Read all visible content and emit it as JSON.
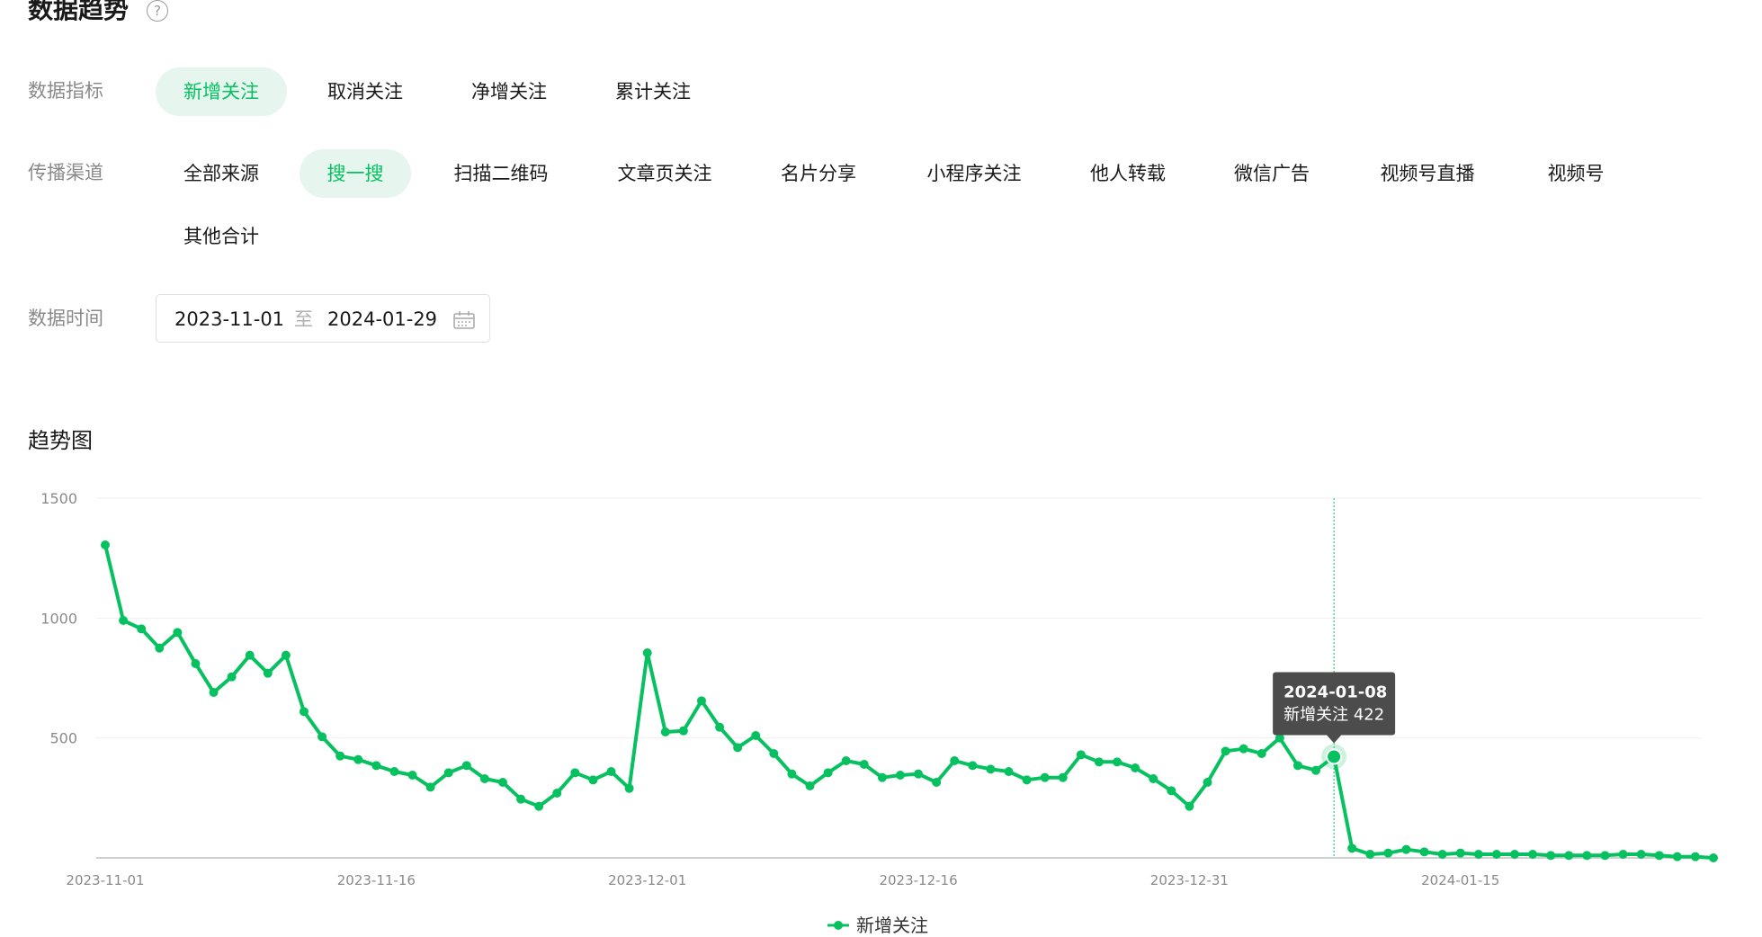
{
  "page": {
    "title": "数据趋势",
    "help_glyph": "?"
  },
  "filters": {
    "metric_label": "数据指标",
    "metrics": [
      "新增关注",
      "取消关注",
      "净增关注",
      "累计关注"
    ],
    "active_metric_index": 0,
    "channel_label": "传播渠道",
    "channels": [
      "全部来源",
      "搜一搜",
      "扫描二维码",
      "文章页关注",
      "名片分享",
      "小程序关注",
      "他人转载",
      "微信广告",
      "视频号直播",
      "视频号",
      "其他合计"
    ],
    "active_channel_index": 1,
    "time_label": "数据时间",
    "date_start": "2023-11-01",
    "date_separator": "至",
    "date_end": "2024-01-29"
  },
  "section": {
    "title": "趋势图"
  },
  "colors": {
    "accent": "#07c160",
    "accent_bg": "#e6f6ee",
    "tooltip_bg": "#4c4c4c"
  },
  "chart_data": {
    "type": "line",
    "title": "",
    "xlabel": "",
    "ylabel": "",
    "x_start": "2023-11-01",
    "x": [
      "2023-11-01",
      "2023-11-02",
      "2023-11-03",
      "2023-11-04",
      "2023-11-05",
      "2023-11-06",
      "2023-11-07",
      "2023-11-08",
      "2023-11-09",
      "2023-11-10",
      "2023-11-11",
      "2023-11-12",
      "2023-11-13",
      "2023-11-14",
      "2023-11-15",
      "2023-11-16",
      "2023-11-17",
      "2023-11-18",
      "2023-11-19",
      "2023-11-20",
      "2023-11-21",
      "2023-11-22",
      "2023-11-23",
      "2023-11-24",
      "2023-11-25",
      "2023-11-26",
      "2023-11-27",
      "2023-11-28",
      "2023-11-29",
      "2023-11-30",
      "2023-12-01",
      "2023-12-02",
      "2023-12-03",
      "2023-12-04",
      "2023-12-05",
      "2023-12-06",
      "2023-12-07",
      "2023-12-08",
      "2023-12-09",
      "2023-12-10",
      "2023-12-11",
      "2023-12-12",
      "2023-12-13",
      "2023-12-14",
      "2023-12-15",
      "2023-12-16",
      "2023-12-17",
      "2023-12-18",
      "2023-12-19",
      "2023-12-20",
      "2023-12-21",
      "2023-12-22",
      "2023-12-23",
      "2023-12-24",
      "2023-12-25",
      "2023-12-26",
      "2023-12-27",
      "2023-12-28",
      "2023-12-29",
      "2023-12-30",
      "2023-12-31",
      "2024-01-01",
      "2024-01-02",
      "2024-01-03",
      "2024-01-04",
      "2024-01-05",
      "2024-01-06",
      "2024-01-07",
      "2024-01-08",
      "2024-01-09",
      "2024-01-10",
      "2024-01-11",
      "2024-01-12",
      "2024-01-13",
      "2024-01-14",
      "2024-01-15",
      "2024-01-16",
      "2024-01-17",
      "2024-01-18",
      "2024-01-19",
      "2024-01-20",
      "2024-01-21",
      "2024-01-22",
      "2024-01-23",
      "2024-01-24",
      "2024-01-25",
      "2024-01-26",
      "2024-01-27",
      "2024-01-28",
      "2024-01-29"
    ],
    "series": [
      {
        "name": "新增关注",
        "values": [
          1305,
          990,
          955,
          875,
          940,
          810,
          690,
          755,
          845,
          770,
          845,
          610,
          505,
          425,
          410,
          385,
          360,
          345,
          295,
          355,
          385,
          330,
          315,
          245,
          215,
          270,
          355,
          325,
          360,
          290,
          855,
          525,
          530,
          655,
          545,
          460,
          510,
          435,
          350,
          300,
          355,
          405,
          390,
          335,
          345,
          350,
          315,
          405,
          385,
          370,
          360,
          325,
          335,
          335,
          430,
          400,
          400,
          375,
          330,
          280,
          215,
          315,
          445,
          455,
          435,
          500,
          385,
          365,
          422,
          40,
          15,
          20,
          35,
          25,
          15,
          20,
          15,
          15,
          15,
          15,
          10,
          10,
          10,
          10,
          15,
          15,
          10,
          5,
          5,
          0
        ]
      }
    ],
    "ylim": [
      0,
      1500
    ],
    "yticks": [
      500,
      1000,
      1500
    ],
    "xtick_labels": [
      "2023-11-01",
      "2023-11-16",
      "2023-12-01",
      "2023-12-16",
      "2023-12-31",
      "2024-01-15"
    ],
    "grid": true,
    "legend": "bottom-center",
    "highlight": {
      "index": 68,
      "date": "2024-01-08",
      "label": "新增关注 422"
    }
  }
}
